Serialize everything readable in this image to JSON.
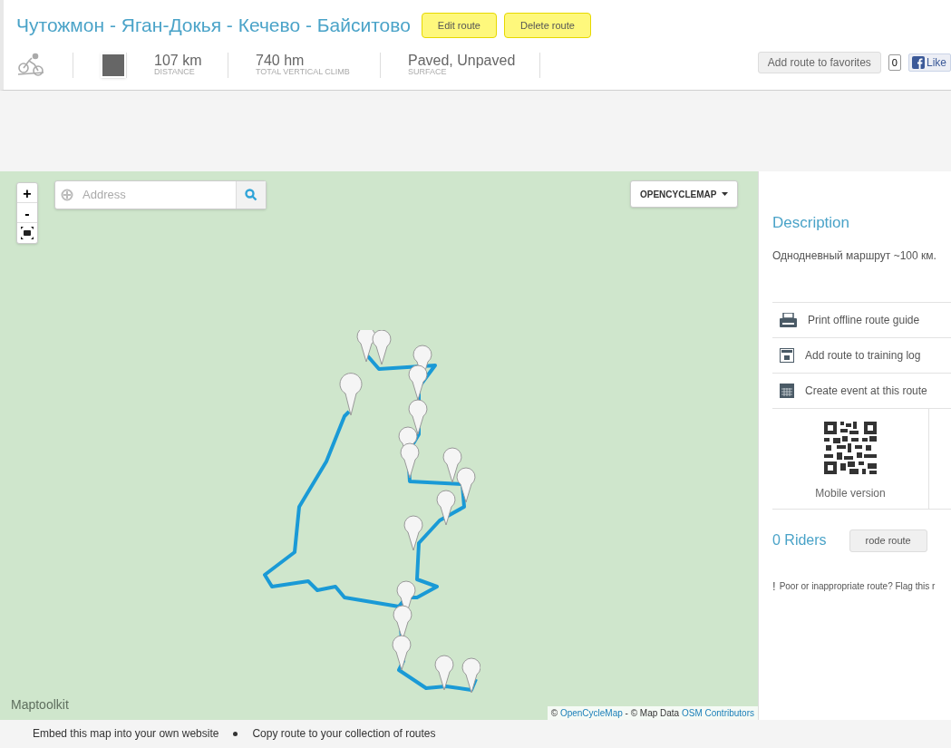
{
  "route": {
    "title": "Чутожмон - Яган-Докья - Кечево - Байситово",
    "actions": [
      "Edit route",
      "Delete route"
    ]
  },
  "stats": [
    {
      "kind": "distance",
      "value": "107 km",
      "label": "DISTANCE"
    },
    {
      "kind": "climb",
      "value": "740 hm",
      "label": "TOTAL VERTICAL CLIMB"
    },
    {
      "kind": "surface",
      "value": "Paved, Unpaved",
      "label": "SURFACE"
    }
  ],
  "social": {
    "favorites_button": "Add route to favorites",
    "favorites_count": "0",
    "like_button": "Like"
  },
  "map": {
    "zoom_in": "+",
    "zoom_out": "-",
    "search": {
      "placeholder": "Address"
    },
    "layer_button": "OPENCYCLEMAP",
    "logo": "Maptoolkit",
    "attribution": [
      {
        "text": "© ",
        "link": false
      },
      {
        "text": "OpenCycleMap",
        "link": true
      },
      {
        "text": " - © Map Data ",
        "link": false
      },
      {
        "text": "OSM Contributors",
        "link": true
      }
    ]
  },
  "map_links": [
    "Embed this map into your own website",
    "Copy route to your collection of routes"
  ],
  "sidebar": {
    "description_title": "Description",
    "description": "Однодневный маршрут ~100 км.",
    "actions": [
      {
        "kind": "print",
        "label": "Print offline route guide"
      },
      {
        "kind": "log",
        "label": "Add route to training log"
      },
      {
        "kind": "event",
        "label": "Create event at this route"
      }
    ],
    "mobile_label": "Mobile version",
    "riders": "0 Riders",
    "rode_button": "rode route",
    "flag_mark": "!",
    "flag_text": "Poor or inappropriate route? Flag this r"
  }
}
